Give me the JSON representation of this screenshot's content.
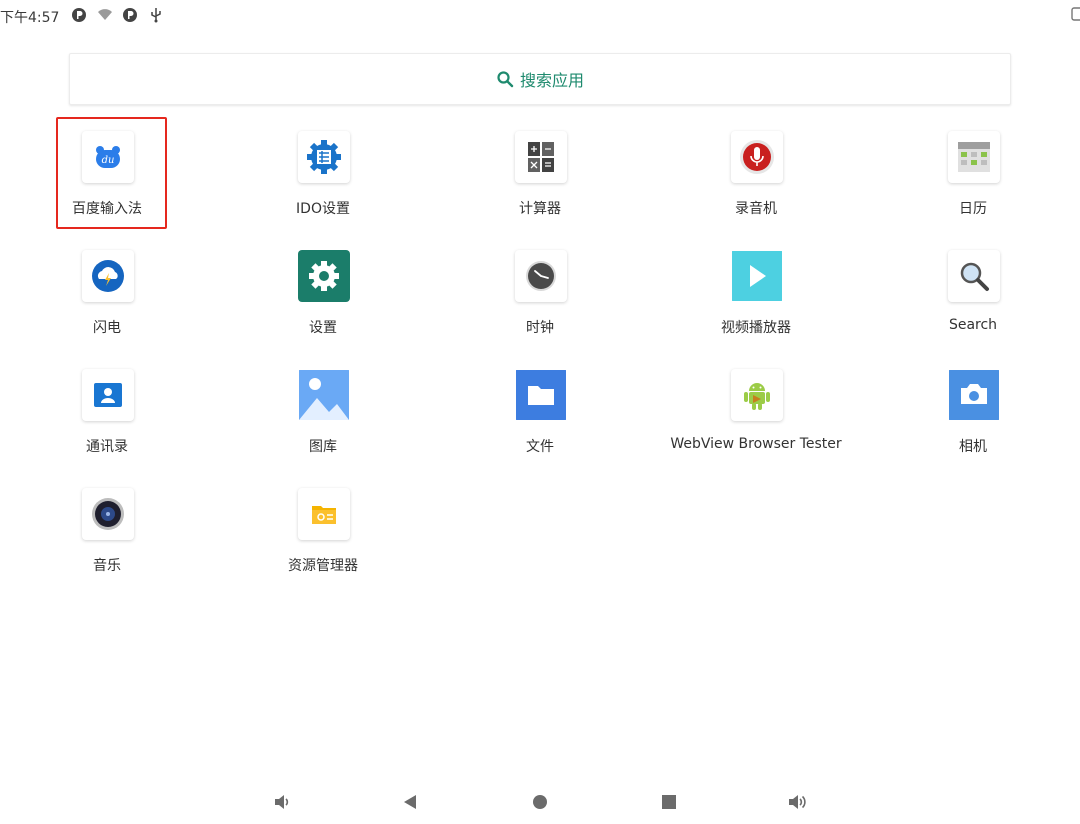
{
  "status_bar": {
    "time": "下午4:57",
    "icons": [
      "app-notification-icon",
      "wifi-icon",
      "app-notification-icon",
      "usb-icon"
    ]
  },
  "search": {
    "label": "搜索应用",
    "icon": "search-icon"
  },
  "apps": [
    {
      "label": "百度输入法",
      "icon": "baidu-ime-icon",
      "selected": true
    },
    {
      "label": "IDO设置",
      "icon": "ido-settings-icon"
    },
    {
      "label": "计算器",
      "icon": "calculator-icon"
    },
    {
      "label": "录音机",
      "icon": "recorder-icon"
    },
    {
      "label": "日历",
      "icon": "calendar-icon"
    },
    {
      "label": "闪电",
      "icon": "lightning-icon"
    },
    {
      "label": "设置",
      "icon": "settings-icon"
    },
    {
      "label": "时钟",
      "icon": "clock-icon"
    },
    {
      "label": "视频播放器",
      "icon": "video-player-icon"
    },
    {
      "label": "Search",
      "icon": "search-app-icon"
    },
    {
      "label": "通讯录",
      "icon": "contacts-icon"
    },
    {
      "label": "图库",
      "icon": "gallery-icon"
    },
    {
      "label": "文件",
      "icon": "files-icon"
    },
    {
      "label": "WebView Browser Tester",
      "icon": "android-icon"
    },
    {
      "label": "相机",
      "icon": "camera-icon"
    },
    {
      "label": "音乐",
      "icon": "music-icon"
    },
    {
      "label": "资源管理器",
      "icon": "file-manager-icon"
    }
  ],
  "nav_bar": [
    "volume-down-icon",
    "back-icon",
    "home-icon",
    "recents-icon",
    "volume-up-icon"
  ],
  "colors": {
    "accent": "#1e8a6e",
    "highlight": "#e5281e",
    "nav": "#6b6b6b"
  }
}
